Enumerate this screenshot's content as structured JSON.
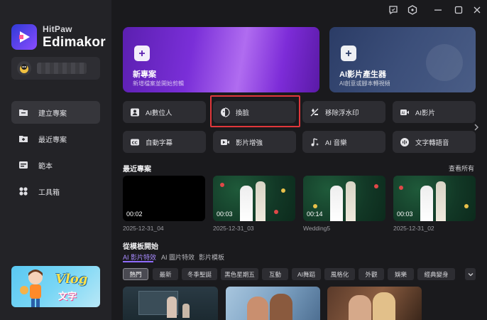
{
  "app": {
    "brand_line1": "HitPaw",
    "brand_line2": "Edimakor"
  },
  "sidebar": {
    "items": [
      {
        "label": "建立專案",
        "icon": "folder-icon"
      },
      {
        "label": "最近專案",
        "icon": "folder-plus-icon"
      },
      {
        "label": "範本",
        "icon": "template-icon"
      },
      {
        "label": "工具箱",
        "icon": "toolbox-icon"
      }
    ],
    "promo": {
      "line1": "Vlog",
      "line2": "文字"
    }
  },
  "hero": {
    "new_project": {
      "title": "新專案",
      "subtitle": "新增檔案並開始剪輯"
    },
    "ai_video": {
      "title": "AI影片產生器",
      "subtitle": "AI創意或腳本轉視頻"
    }
  },
  "tools": {
    "row1": [
      "AI數位人",
      "換臉",
      "移除浮水印",
      "AI影片"
    ],
    "row2": [
      "自動字幕",
      "影片增強",
      "AI 音樂",
      "文字轉語音"
    ]
  },
  "recent": {
    "title": "最近專案",
    "see_all": "查看所有",
    "projects": [
      {
        "duration": "00:02",
        "name": "2025-12-31_04"
      },
      {
        "duration": "00:03",
        "name": "2025-12-31_03"
      },
      {
        "duration": "00:14",
        "name": "Wedding5"
      },
      {
        "duration": "00:03",
        "name": "2025-12-31_02"
      }
    ]
  },
  "templates": {
    "title": "從模板開始",
    "tabs": [
      "AI 影片特效",
      "AI 圖片特效",
      "影片模板"
    ],
    "chips": [
      "熱門",
      "最新",
      "冬季聖誕",
      "黑色星期五",
      "互動",
      "AI舞蹈",
      "風格化",
      "外觀",
      "娛樂",
      "經典變身"
    ]
  },
  "colors": {
    "accent": "#8f6bff",
    "highlight": "#e0373b"
  }
}
